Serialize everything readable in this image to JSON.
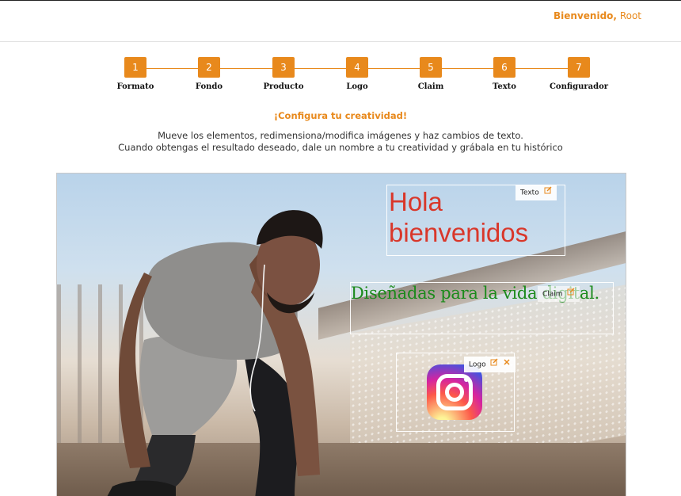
{
  "header": {
    "welcome_label": "Bienvenido,",
    "user_name": "Root"
  },
  "steps": [
    {
      "num": "1",
      "label": "Formato"
    },
    {
      "num": "2",
      "label": "Fondo"
    },
    {
      "num": "3",
      "label": "Producto"
    },
    {
      "num": "4",
      "label": "Logo"
    },
    {
      "num": "5",
      "label": "Claim"
    },
    {
      "num": "6",
      "label": "Texto"
    },
    {
      "num": "7",
      "label": "Configurador"
    }
  ],
  "intro": {
    "title": "¡Configura tu creatividad!",
    "line1": "Mueve los elementos, redimensiona/modifica imágenes y haz cambios de texto.",
    "line2": "Cuando obtengas el resultado deseado, dale un nombre a tu creatividad y grábala en tu histórico"
  },
  "canvas": {
    "text_element": {
      "tag": "Texto",
      "content": "Hola bienvenidos",
      "color": "#d9372a"
    },
    "claim_element": {
      "tag": "Claim",
      "content": "Diseñadas para la vida digital.",
      "color": "#1b8a1b"
    },
    "logo_element": {
      "tag": "Logo",
      "logo_icon": "instagram-logo-icon"
    }
  },
  "colors": {
    "accent": "#e8891c"
  }
}
